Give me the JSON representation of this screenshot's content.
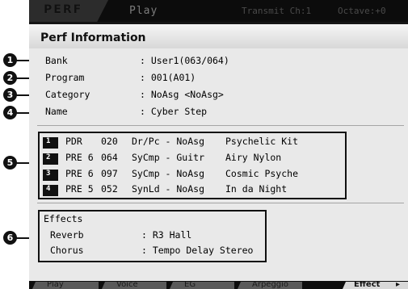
{
  "header": {
    "mode": "PERF",
    "title": "Play",
    "transmit": "Transmit Ch:1",
    "octave": "Octave:+0"
  },
  "panel": {
    "title": "Perf Information"
  },
  "info": {
    "bank": {
      "label": "Bank",
      "value": ": User1(063/064)"
    },
    "program": {
      "label": "Program",
      "value": ": 001(A01)"
    },
    "category": {
      "label": "Category",
      "value": ": NoAsg <NoAsg>"
    },
    "name": {
      "label": "Name",
      "value": ": Cyber Step"
    }
  },
  "parts": [
    {
      "num": "1",
      "bank": "PDR",
      "number": "020",
      "category": "Dr/Pc - NoAsg",
      "voice": "Psychelic Kit"
    },
    {
      "num": "2",
      "bank": "PRE 6",
      "number": "064",
      "category": "SyCmp - Guitr",
      "voice": "Airy Nylon"
    },
    {
      "num": "3",
      "bank": "PRE 6",
      "number": "097",
      "category": "SyCmp - NoAsg",
      "voice": "Cosmic Psyche"
    },
    {
      "num": "4",
      "bank": "PRE 5",
      "number": "052",
      "category": "SynLd - NoAsg",
      "voice": "In da Night"
    }
  ],
  "effects": {
    "heading": "Effects",
    "reverb": {
      "label": "Reverb",
      "value": ": R3 Hall"
    },
    "chorus": {
      "label": "Chorus",
      "value": ": Tempo Delay Stereo"
    }
  },
  "bottom_tabs": [
    "Play",
    "Voice",
    "EG",
    "Arpeggio",
    "Effect"
  ],
  "callouts": [
    "1",
    "2",
    "3",
    "4",
    "5",
    "6"
  ],
  "icons": {
    "more": "right-arrow-icon"
  }
}
